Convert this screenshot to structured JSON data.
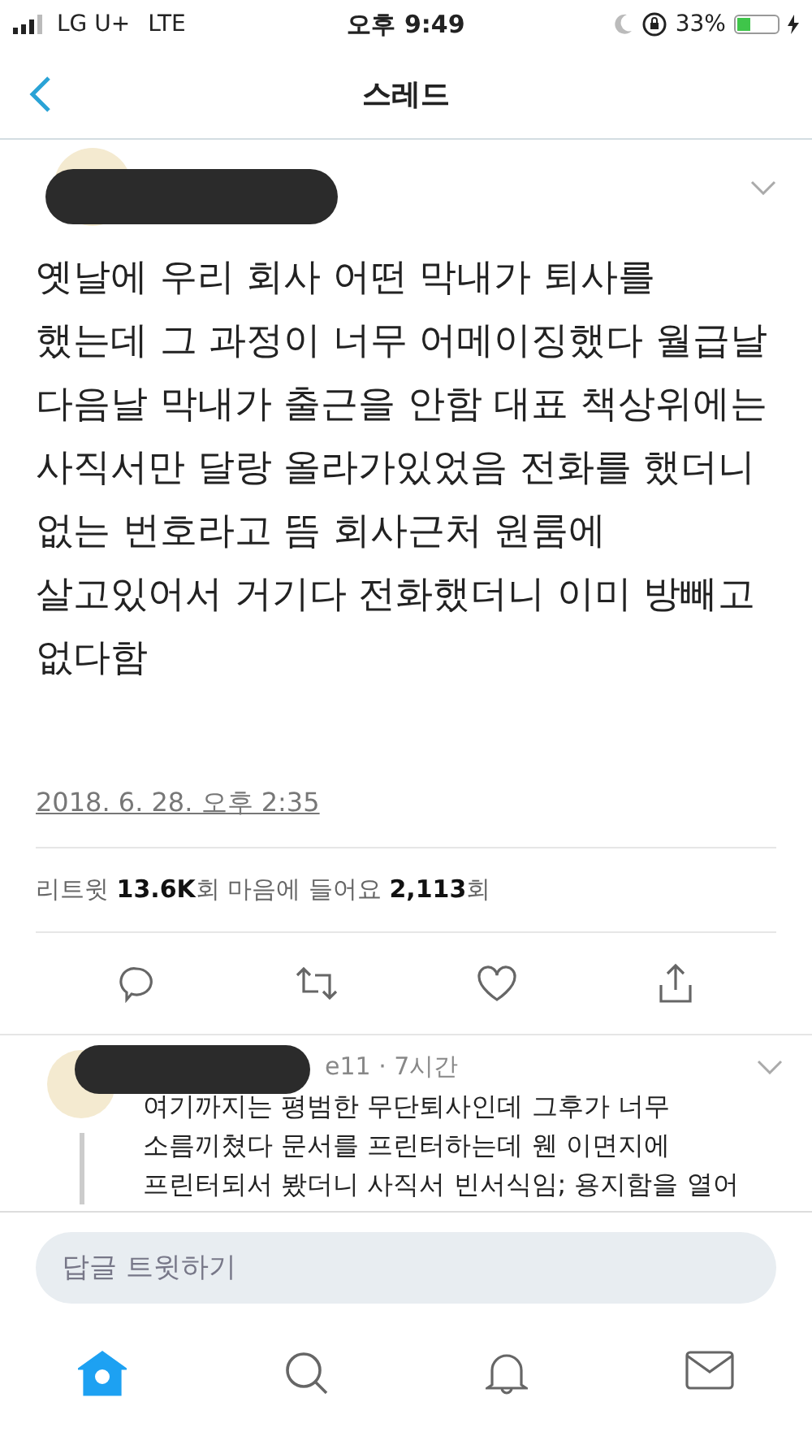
{
  "status_bar": {
    "carrier": "LG U+",
    "network": "LTE",
    "time": "오후 9:49",
    "battery": "33%"
  },
  "nav": {
    "title": "스레드"
  },
  "tweet": {
    "text": "옛날에 우리 회사 어떤 막내가 퇴사를 했는데 그 과정이 너무 어메이징했다 월급날 다음날 막내가 출근을 안함 대표 책상위에는 사직서만 달랑 올라가있었음 전화를 했더니 없는 번호라고 뜸 회사근처 원룸에 살고있어서 거기다 전화했더니 이미 방빼고 없다함",
    "date": "2018. 6. 28. 오후 2:35",
    "stats": "리트윗 **13.6K**회  마음에 들어요 **2,113**회"
  },
  "reply": {
    "meta": "e11 · 7시간",
    "text": "여기까지는 평범한 무단퇴사인데 그후가 너무 소름끼쳤다 문서를 프린터하는데 웬 이면지에 프린터되서 봤더니 사직서 빈서식임; 용지함을 열어"
  },
  "composer": {
    "placeholder": "답글 트윗하기"
  },
  "tab_bar": [
    {
      "kind": "home",
      "selected": true
    },
    {
      "kind": "search",
      "selected": false
    },
    {
      "kind": "bell",
      "selected": false
    },
    {
      "kind": "mail",
      "selected": false
    }
  ]
}
